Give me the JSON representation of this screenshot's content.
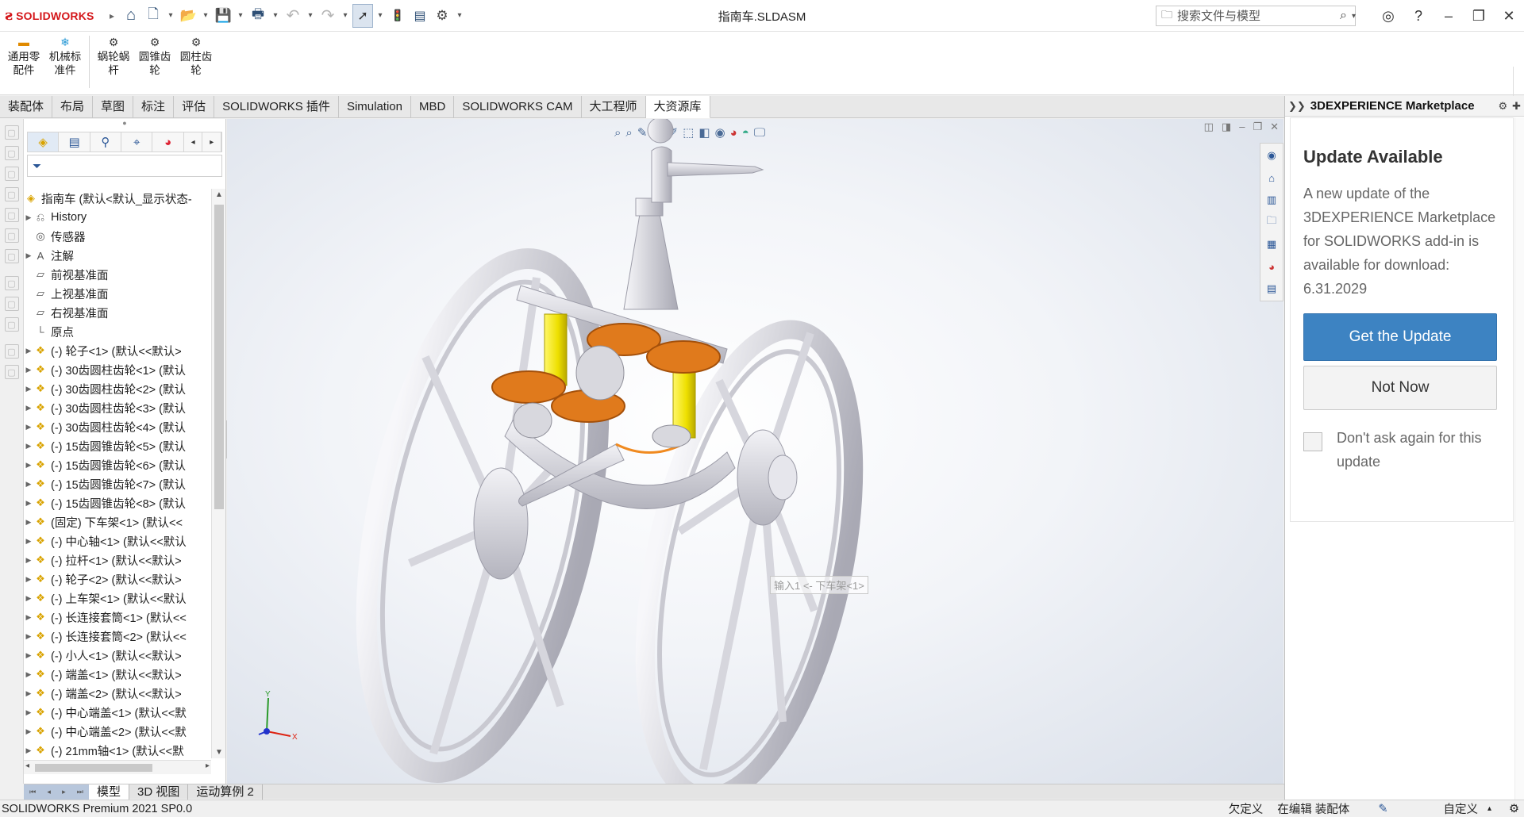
{
  "app": {
    "logo_text": "SOLIDWORKS",
    "document_title": "指南车.SLDASM"
  },
  "search": {
    "placeholder": "搜索文件与模型"
  },
  "ribbon": {
    "buttons": [
      {
        "label": "通用零配件",
        "icon": "toolbox-icon"
      },
      {
        "label": "机械标准件",
        "icon": "snowflake-icon"
      },
      {
        "label": "蜗轮蜗杆",
        "icon": "worm-gear-icon"
      },
      {
        "label": "圆锥齿轮",
        "icon": "bevel-gear-icon"
      },
      {
        "label": "圆柱齿轮",
        "icon": "spur-gear-icon"
      }
    ]
  },
  "command_tabs": [
    "装配体",
    "布局",
    "草图",
    "标注",
    "评估",
    "SOLIDWORKS 插件",
    "Simulation",
    "MBD",
    "SOLIDWORKS CAM",
    "大工程师",
    "大资源库"
  ],
  "active_command_tab": "大资源库",
  "feature_tree": {
    "root": "指南车 (默认<默认_显示状态-",
    "items": [
      {
        "text": "History",
        "icon": "history-icon",
        "expandable": true
      },
      {
        "text": "传感器",
        "icon": "sensor-icon",
        "expandable": false
      },
      {
        "text": "注解",
        "icon": "annotation-icon",
        "expandable": true
      },
      {
        "text": "前视基准面",
        "icon": "plane-icon",
        "expandable": false
      },
      {
        "text": "上视基准面",
        "icon": "plane-icon",
        "expandable": false
      },
      {
        "text": "右视基准面",
        "icon": "plane-icon",
        "expandable": false
      },
      {
        "text": "原点",
        "icon": "origin-icon",
        "expandable": false
      },
      {
        "text": "(-) 轮子<1> (默认<<默认>",
        "icon": "part-icon",
        "expandable": true
      },
      {
        "text": "(-) 30齿圆柱齿轮<1> (默认",
        "icon": "part-icon",
        "expandable": true
      },
      {
        "text": "(-) 30齿圆柱齿轮<2> (默认",
        "icon": "part-icon",
        "expandable": true
      },
      {
        "text": "(-) 30齿圆柱齿轮<3> (默认",
        "icon": "part-icon",
        "expandable": true
      },
      {
        "text": "(-) 30齿圆柱齿轮<4> (默认",
        "icon": "part-icon",
        "expandable": true
      },
      {
        "text": "(-) 15齿圆锥齿轮<5> (默认",
        "icon": "part-icon",
        "expandable": true
      },
      {
        "text": "(-) 15齿圆锥齿轮<6> (默认",
        "icon": "part-icon",
        "expandable": true
      },
      {
        "text": "(-) 15齿圆锥齿轮<7> (默认",
        "icon": "part-icon",
        "expandable": true
      },
      {
        "text": "(-) 15齿圆锥齿轮<8> (默认",
        "icon": "part-icon",
        "expandable": true
      },
      {
        "text": "(固定) 下车架<1> (默认<<",
        "icon": "part-icon",
        "expandable": true
      },
      {
        "text": "(-) 中心轴<1> (默认<<默认",
        "icon": "part-icon",
        "expandable": true
      },
      {
        "text": "(-) 拉杆<1> (默认<<默认>",
        "icon": "part-icon",
        "expandable": true
      },
      {
        "text": "(-) 轮子<2> (默认<<默认>",
        "icon": "part-icon",
        "expandable": true
      },
      {
        "text": "(-) 上车架<1> (默认<<默认",
        "icon": "part-icon",
        "expandable": true
      },
      {
        "text": "(-) 长连接套筒<1> (默认<<",
        "icon": "part-icon",
        "expandable": true
      },
      {
        "text": "(-) 长连接套筒<2> (默认<<",
        "icon": "part-icon",
        "expandable": true
      },
      {
        "text": "(-) 小人<1> (默认<<默认>",
        "icon": "part-icon",
        "expandable": true
      },
      {
        "text": "(-) 端盖<1> (默认<<默认>",
        "icon": "part-icon",
        "expandable": true
      },
      {
        "text": "(-) 端盖<2> (默认<<默认>",
        "icon": "part-icon",
        "expandable": true
      },
      {
        "text": "(-) 中心端盖<1> (默认<<默",
        "icon": "part-icon",
        "expandable": true
      },
      {
        "text": "(-) 中心端盖<2> (默认<<默",
        "icon": "part-icon",
        "expandable": true
      },
      {
        "text": "(-) 21mm轴<1> (默认<<默",
        "icon": "part-icon",
        "expandable": true
      }
    ]
  },
  "viewport": {
    "tooltip": "输入1 <- 下车架<1>",
    "triad": {
      "x_label": "X",
      "y_label": "Y"
    }
  },
  "bottom_tabs": [
    "模型",
    "3D 视图",
    "运动算例 2"
  ],
  "active_bottom_tab": "模型",
  "status_bar": {
    "product": "SOLIDWORKS Premium 2021 SP0.0",
    "state": "欠定义",
    "mode": "在编辑 装配体",
    "units": "自定义"
  },
  "marketplace": {
    "panel_title": "3DEXPERIENCE Marketplace",
    "heading": "Update Available",
    "message": "A new update of the 3DEXPERIENCE Marketplace for SOLIDWORKS add-in is available for download: 6.31.2029",
    "primary_button": "Get the Update",
    "secondary_button": "Not Now",
    "checkbox_label": "Don't ask again for this update",
    "checkbox_checked": false
  },
  "colors": {
    "brand_red": "#d4161a",
    "primary_button": "#3d83c2",
    "part_icon": "#d9a300",
    "gear_orange": "#e07a1c",
    "shaft_yellow": "#f2e800"
  }
}
